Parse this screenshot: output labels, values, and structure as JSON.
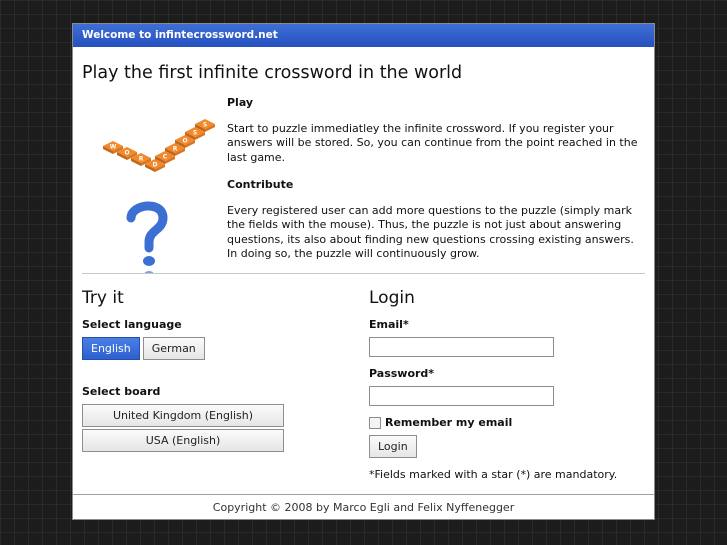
{
  "window": {
    "title": "Welcome to infintecrossword.net"
  },
  "headline": "Play the first infinite crossword in the world",
  "logo": {
    "icon": "crossword-question-logo",
    "tiles": [
      "W",
      "O",
      "R",
      "D",
      "C",
      "R",
      "O",
      "S",
      "S"
    ]
  },
  "intro": {
    "play_heading": "Play",
    "play_text": "Start to puzzle immediatley the infinite crossword. If you register your answers will be stored. So, you can continue from the point reached in the last game.",
    "contribute_heading": "Contribute",
    "contribute_text": "Every registered user can add more questions to the puzzle (simply mark the fields with the mouse). Thus, the puzzle is not just about answering questions, its also about finding new questions crossing existing answers. In doing so, the puzzle will continuously grow."
  },
  "try_it": {
    "title": "Try it",
    "select_language_label": "Select language",
    "languages": [
      "English",
      "German"
    ],
    "selected_language": "English",
    "select_board_label": "Select board",
    "boards": [
      "United Kingdom (English)",
      "USA (English)"
    ]
  },
  "login": {
    "title": "Login",
    "email_label": "Email*",
    "email_value": "",
    "password_label": "Password*",
    "password_value": "",
    "remember_label": "Remember my email",
    "remember_checked": false,
    "login_button": "Login",
    "note": "*Fields marked with a star (*) are mandatory."
  },
  "footer": {
    "copyright": "Copyright © 2008 by Marco Egli and Felix Nyffenegger"
  },
  "colors": {
    "titlebar": "#2a5bd0",
    "tile": "#f08a2c",
    "question_mark": "#3b6fd1"
  }
}
